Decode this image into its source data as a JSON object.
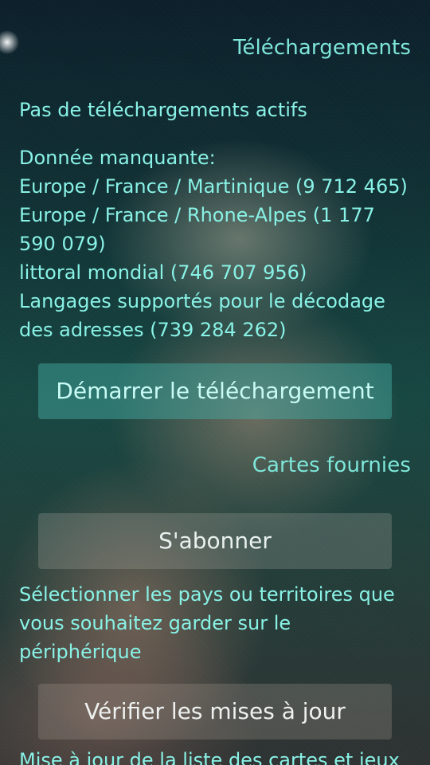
{
  "downloads": {
    "title": "Téléchargements",
    "active_status": "Pas de téléchargements actifs",
    "missing_data": {
      "heading": "Donnée manquante:",
      "items": [
        "Europe / France / Martinique (9 712 465)",
        "Europe / France / Rhone-Alpes (1 177 590 079)",
        "littoral mondial (746 707 956)",
        "Langages supportés pour le décodage des adresses (739 284 262)"
      ]
    },
    "start_button": "Démarrer le téléchargement"
  },
  "provided_maps": {
    "title": "Cartes fournies",
    "subscribe_button": "S'abonner",
    "select_description": "Sélectionner les pays ou territoires que vous souhaitez garder sur le périphérique",
    "check_updates_button": "Vérifier les mises à jour",
    "check_updates_description": "Mise à jour de la liste des cartes et jeux de"
  },
  "theme": {
    "accent": "#86ede2",
    "button_accent": "#46aaa0"
  }
}
